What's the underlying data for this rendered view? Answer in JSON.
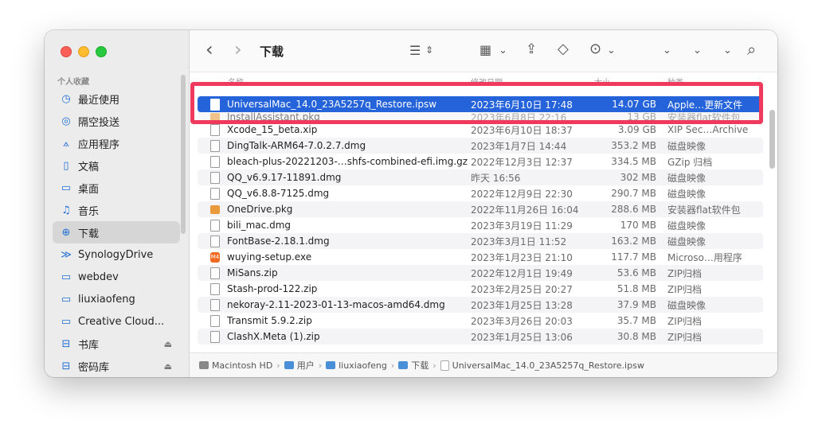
{
  "toolbar": {
    "title": "下载",
    "back_icon": "‹",
    "forward_icon": "›",
    "list_icon": "☰",
    "group_icon": "▦",
    "share_icon": "⇪",
    "tag_icon": "◇",
    "more_icon": "⊙",
    "chev": "⌄",
    "search_icon": "⌕"
  },
  "sidebar": {
    "section_title": "个人收藏",
    "items": [
      {
        "label": "最近使用",
        "icon": "clock-icon",
        "glyph": "◷"
      },
      {
        "label": "隔空投送",
        "icon": "airdrop-icon",
        "glyph": "◎"
      },
      {
        "label": "应用程序",
        "icon": "apps-icon",
        "glyph": "⟑"
      },
      {
        "label": "文稿",
        "icon": "document-icon",
        "glyph": "▯"
      },
      {
        "label": "桌面",
        "icon": "desktop-icon",
        "glyph": "▭"
      },
      {
        "label": "音乐",
        "icon": "music-icon",
        "glyph": "♫"
      },
      {
        "label": "下载",
        "icon": "download-icon",
        "glyph": "⊕"
      },
      {
        "label": "SynologyDrive",
        "icon": "synology-icon",
        "glyph": "≫"
      },
      {
        "label": "webdev",
        "icon": "folder-icon",
        "glyph": "▭"
      },
      {
        "label": "liuxiaofeng",
        "icon": "folder-icon",
        "glyph": "▭"
      },
      {
        "label": "Creative Cloud...",
        "icon": "folder-icon",
        "glyph": "▭"
      },
      {
        "label": "书库",
        "icon": "drive-icon",
        "glyph": "⊟",
        "eject": "⏏"
      },
      {
        "label": "密码库",
        "icon": "drive-icon",
        "glyph": "⊟",
        "eject": "⏏"
      }
    ]
  },
  "columns": {
    "name": "名称",
    "date": "修改日期",
    "size": "大小",
    "kind": "种类"
  },
  "files": [
    {
      "name": "UniversalMac_14.0_23A5257q_Restore.ipsw",
      "date": "2023年6月10日 17:48",
      "size": "14.07 GB",
      "kind": "Apple…更新文件",
      "icon": "file"
    },
    {
      "name": "InstallAssistant.pkg",
      "date": "2023年6月8日 22:16",
      "size": "13 GB",
      "kind": "安装器flat软件包",
      "icon": "pkg"
    },
    {
      "name": "Xcode_15_beta.xip",
      "date": "2023年6月10日 18:37",
      "size": "3.09 GB",
      "kind": "XIP Sec…Archive",
      "icon": "file"
    },
    {
      "name": "DingTalk-ARM64-7.0.2.7.dmg",
      "date": "2023年1月7日 14:44",
      "size": "353.2 MB",
      "kind": "磁盘映像",
      "icon": "file"
    },
    {
      "name": "bleach-plus-20221203-…shfs-combined-efi.img.gz",
      "date": "2022年12月3日 12:37",
      "size": "334.5 MB",
      "kind": "GZip 归档",
      "icon": "file"
    },
    {
      "name": "QQ_v6.9.17-11891.dmg",
      "date": "昨天 16:56",
      "size": "302 MB",
      "kind": "磁盘映像",
      "icon": "file"
    },
    {
      "name": "QQ_v6.8.8-7125.dmg",
      "date": "2022年12月9日 22:30",
      "size": "290.7 MB",
      "kind": "磁盘映像",
      "icon": "file"
    },
    {
      "name": "OneDrive.pkg",
      "date": "2022年11月26日 16:04",
      "size": "288.6 MB",
      "kind": "安装器flat软件包",
      "icon": "pkg"
    },
    {
      "name": "bili_mac.dmg",
      "date": "2023年3月19日 11:29",
      "size": "170 MB",
      "kind": "磁盘映像",
      "icon": "file"
    },
    {
      "name": "FontBase-2.18.1.dmg",
      "date": "2023年3月1日 11:52",
      "size": "163.2 MB",
      "kind": "磁盘映像",
      "icon": "file"
    },
    {
      "name": "wuying-setup.exe",
      "date": "2023年1月23日 21:10",
      "size": "117.7 MB",
      "kind": "Microso…用程序",
      "icon": "exe"
    },
    {
      "name": "MiSans.zip",
      "date": "2022年12月1日 19:49",
      "size": "53.6 MB",
      "kind": "ZIP归档",
      "icon": "file"
    },
    {
      "name": "Stash-prod-122.zip",
      "date": "2023年2月25日 20:27",
      "size": "51.8 MB",
      "kind": "ZIP归档",
      "icon": "file"
    },
    {
      "name": "nekoray-2.11-2023-01-13-macos-amd64.dmg",
      "date": "2023年1月25日 13:28",
      "size": "37.9 MB",
      "kind": "磁盘映像",
      "icon": "file"
    },
    {
      "name": "Transmit 5.9.2.zip",
      "date": "2023年3月26日 20:03",
      "size": "35.7 MB",
      "kind": "ZIP归档",
      "icon": "file"
    },
    {
      "name": "ClashX.Meta (1).zip",
      "date": "2023年1月25日 13:06",
      "size": "30.8 MB",
      "kind": "ZIP归档",
      "icon": "file"
    }
  ],
  "pathbar": [
    "Macintosh HD",
    "用户",
    "liuxiaofeng",
    "下载",
    "UniversalMac_14.0_23A5257q_Restore.ipsw"
  ],
  "exe_label": "M4",
  "crumb_sep": "›"
}
